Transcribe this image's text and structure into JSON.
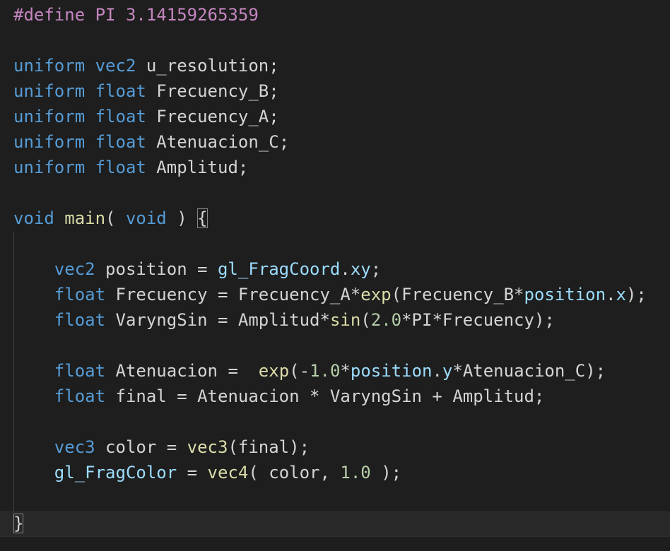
{
  "theme": {
    "background": "#1e1e1e",
    "keyword": "#569cd6",
    "preprocessor": "#c586c0",
    "function": "#dcdcaa",
    "variable": "#9cdcfe",
    "number": "#b5cea8",
    "text": "#d4d4d4"
  },
  "lines": [
    {
      "tokens": [
        [
          "#define PI 3.14159265359",
          "pre"
        ]
      ]
    },
    {
      "tokens": []
    },
    {
      "tokens": [
        [
          "uniform",
          "kw"
        ],
        [
          " ",
          "txt"
        ],
        [
          "vec2",
          "kw"
        ],
        [
          " u_resolution;",
          "txt"
        ]
      ]
    },
    {
      "tokens": [
        [
          "uniform",
          "kw"
        ],
        [
          " ",
          "txt"
        ],
        [
          "float",
          "kw"
        ],
        [
          " Frecuency_B;",
          "txt"
        ]
      ]
    },
    {
      "tokens": [
        [
          "uniform",
          "kw"
        ],
        [
          " ",
          "txt"
        ],
        [
          "float",
          "kw"
        ],
        [
          " Frecuency_A;",
          "txt"
        ]
      ]
    },
    {
      "tokens": [
        [
          "uniform",
          "kw"
        ],
        [
          " ",
          "txt"
        ],
        [
          "float",
          "kw"
        ],
        [
          " Atenuacion_C;",
          "txt"
        ]
      ]
    },
    {
      "tokens": [
        [
          "uniform",
          "kw"
        ],
        [
          " ",
          "txt"
        ],
        [
          "float",
          "kw"
        ],
        [
          " Amplitud;",
          "txt"
        ]
      ]
    },
    {
      "tokens": []
    },
    {
      "tokens": [
        [
          "void",
          "kw"
        ],
        [
          " ",
          "txt"
        ],
        [
          "main",
          "fn"
        ],
        [
          "( ",
          "txt"
        ],
        [
          "void",
          "kw"
        ],
        [
          " ) ",
          "txt"
        ],
        [
          "{",
          "bracket"
        ]
      ]
    },
    {
      "tokens": []
    },
    {
      "tokens": [
        [
          "    ",
          "txt"
        ],
        [
          "vec2",
          "kw"
        ],
        [
          " position = ",
          "txt"
        ],
        [
          "gl_FragCoord",
          "var"
        ],
        [
          ".",
          "txt"
        ],
        [
          "xy",
          "var"
        ],
        [
          ";",
          "txt"
        ]
      ]
    },
    {
      "tokens": [
        [
          "    ",
          "txt"
        ],
        [
          "float",
          "kw"
        ],
        [
          " Frecuency = Frecuency_A*",
          "txt"
        ],
        [
          "exp",
          "fn"
        ],
        [
          "(Frecuency_B*",
          "txt"
        ],
        [
          "position",
          "var"
        ],
        [
          ".",
          "txt"
        ],
        [
          "x",
          "var"
        ],
        [
          ");",
          "txt"
        ]
      ]
    },
    {
      "tokens": [
        [
          "    ",
          "txt"
        ],
        [
          "float",
          "kw"
        ],
        [
          " VaryngSin = Amplitud*",
          "txt"
        ],
        [
          "sin",
          "fn"
        ],
        [
          "(",
          "txt"
        ],
        [
          "2.0",
          "num"
        ],
        [
          "*PI*Frecuency);",
          "txt"
        ]
      ]
    },
    {
      "tokens": []
    },
    {
      "tokens": [
        [
          "    ",
          "txt"
        ],
        [
          "float",
          "kw"
        ],
        [
          " Atenuacion =  ",
          "txt"
        ],
        [
          "exp",
          "fn"
        ],
        [
          "(-",
          "txt"
        ],
        [
          "1.0",
          "num"
        ],
        [
          "*",
          "txt"
        ],
        [
          "position",
          "var"
        ],
        [
          ".",
          "txt"
        ],
        [
          "y",
          "var"
        ],
        [
          "*Atenuacion_C);",
          "txt"
        ]
      ]
    },
    {
      "tokens": [
        [
          "    ",
          "txt"
        ],
        [
          "float",
          "kw"
        ],
        [
          " final = Atenuacion * VaryngSin + Amplitud;",
          "txt"
        ]
      ]
    },
    {
      "tokens": []
    },
    {
      "tokens": [
        [
          "    ",
          "txt"
        ],
        [
          "vec3",
          "kw"
        ],
        [
          " color = ",
          "txt"
        ],
        [
          "vec3",
          "fn"
        ],
        [
          "(final);",
          "txt"
        ]
      ]
    },
    {
      "tokens": [
        [
          "    ",
          "txt"
        ],
        [
          "gl_FragColor",
          "var"
        ],
        [
          " = ",
          "txt"
        ],
        [
          "vec4",
          "fn"
        ],
        [
          "( color, ",
          "txt"
        ],
        [
          "1.0",
          "num"
        ],
        [
          " );",
          "txt"
        ]
      ]
    },
    {
      "tokens": []
    },
    {
      "tokens": [
        [
          "}",
          "bracket"
        ]
      ]
    }
  ]
}
